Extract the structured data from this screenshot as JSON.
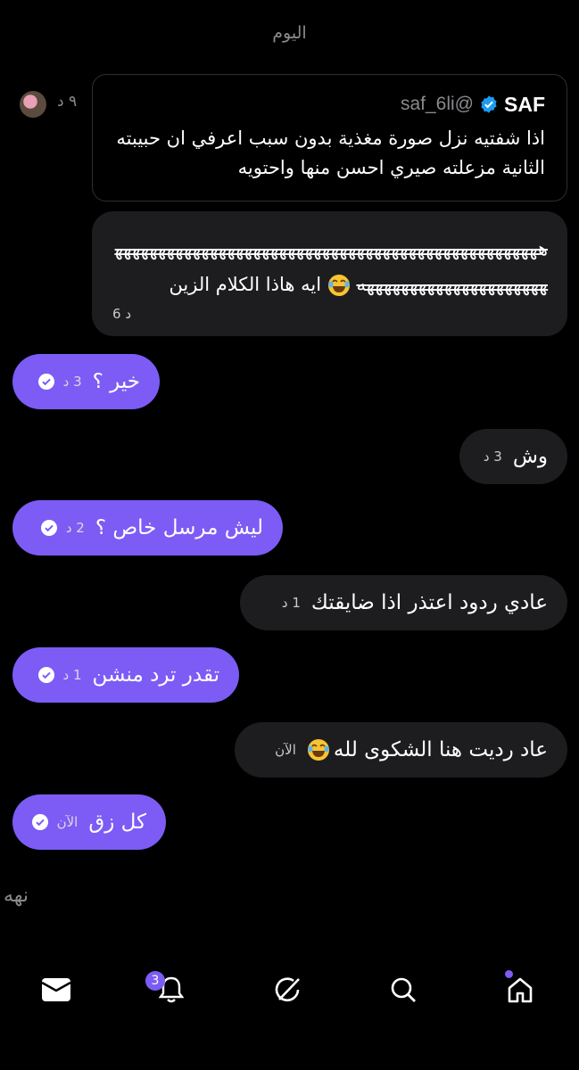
{
  "date_separator": "اليوم",
  "quote": {
    "name": "SAF",
    "handle": "@saf_6li",
    "time": "٩ د",
    "text": "اذا شفتيه نزل صورة مغذية بدون سبب اعرفي ان حبيبته الثانية مزعلته صيري احسن منها واحتويه"
  },
  "laugh_message": {
    "strike_text": "هههههههههههههههههههههههههههههههههههههههههههههههههههههههههههههههههههههههه",
    "text": "ايه هاذا الكلام الزين",
    "time": "6 د"
  },
  "messages": [
    {
      "side": "out",
      "text": "خير ؟",
      "time": "3 د"
    },
    {
      "side": "in",
      "text": "وش",
      "time": "3 د"
    },
    {
      "side": "out",
      "text": "ليش مرسل خاص ؟",
      "time": "2 د"
    },
    {
      "side": "in",
      "text": "عادي ردود اعتذر اذا ضايقتك",
      "time": "1 د"
    },
    {
      "side": "out",
      "text": "تقدر ترد منشن",
      "time": "1 د"
    },
    {
      "side": "in",
      "text": "عاد رديت هنا الشكوى لله",
      "time": "الآن"
    },
    {
      "side": "out",
      "text": "كل زق",
      "time": "الآن"
    }
  ],
  "typing_indicator": "نهه",
  "nav": {
    "items": [
      "mail-icon",
      "bell-icon",
      "grok-icon",
      "search-icon",
      "home-icon"
    ],
    "notification_count": "3"
  },
  "colors": {
    "accent": "#7c5cf5",
    "incoming_bubble": "#1d1d1f",
    "background": "#000000"
  }
}
